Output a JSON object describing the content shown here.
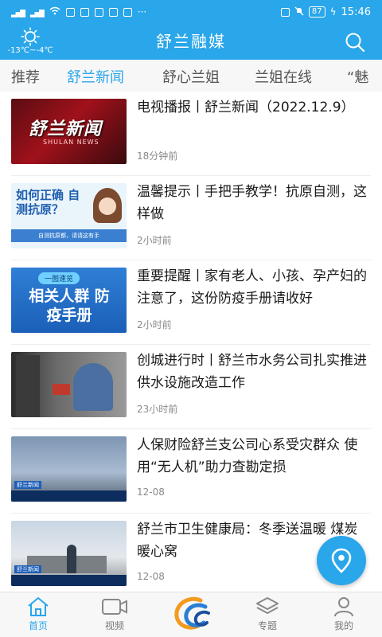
{
  "status_bar": {
    "battery": "87",
    "time": "15:46"
  },
  "header": {
    "title": "舒兰融媒",
    "weather": {
      "temperature": "-13℃~-4℃"
    }
  },
  "tabs": [
    {
      "label": "推荐",
      "active": false
    },
    {
      "label": "舒兰新闻",
      "active": true
    },
    {
      "label": "舒心兰姐",
      "active": false
    },
    {
      "label": "兰姐在线",
      "active": false
    },
    {
      "label": "“魅",
      "active": false
    }
  ],
  "news": [
    {
      "title": "电视播报丨舒兰新闻（2022.12.9）",
      "time": "18分钟前",
      "thumb_text": "舒兰新闻",
      "thumb_sub": "SHULAN NEWS"
    },
    {
      "title": "温馨提示丨手把手教学！抗原自测，这样做",
      "time": "2小时前",
      "thumb_text": "如何正确 自测抗原？",
      "thumb_sub": "自测抗原都，请请这有手"
    },
    {
      "title": "重要提醒丨家有老人、小孩、孕产妇的注意了，这份防疫手册请收好",
      "time": "2小时前",
      "thumb_text": "相关人群 防疫手册",
      "thumb_sub": "一图速览"
    },
    {
      "title": "创城进行时丨舒兰市水务公司扎实推进供水设施改造工作",
      "time": "23小时前",
      "thumb_text": "",
      "thumb_sub": ""
    },
    {
      "title": "人保财险舒兰支公司心系受灾群众 使用“无人机”助力查勘定损",
      "time": "12-08",
      "thumb_text": "舒兰新闻",
      "thumb_sub": ""
    },
    {
      "title": "舒兰市卫生健康局：冬季送温暖 煤炭暖心窝",
      "time": "12-08",
      "thumb_text": "舒兰新闻",
      "thumb_sub": ""
    }
  ],
  "bottom_nav": [
    {
      "label": "首页",
      "icon": "home-icon",
      "active": true
    },
    {
      "label": "视频",
      "icon": "video-icon",
      "active": false
    },
    {
      "label": "",
      "icon": "app-logo-icon",
      "active": false
    },
    {
      "label": "专题",
      "icon": "layers-icon",
      "active": false
    },
    {
      "label": "我的",
      "icon": "profile-icon",
      "active": false
    }
  ],
  "colors": {
    "brand": "#2aa6ea",
    "text": "#1a1a1a",
    "meta": "#8a8a8a"
  }
}
